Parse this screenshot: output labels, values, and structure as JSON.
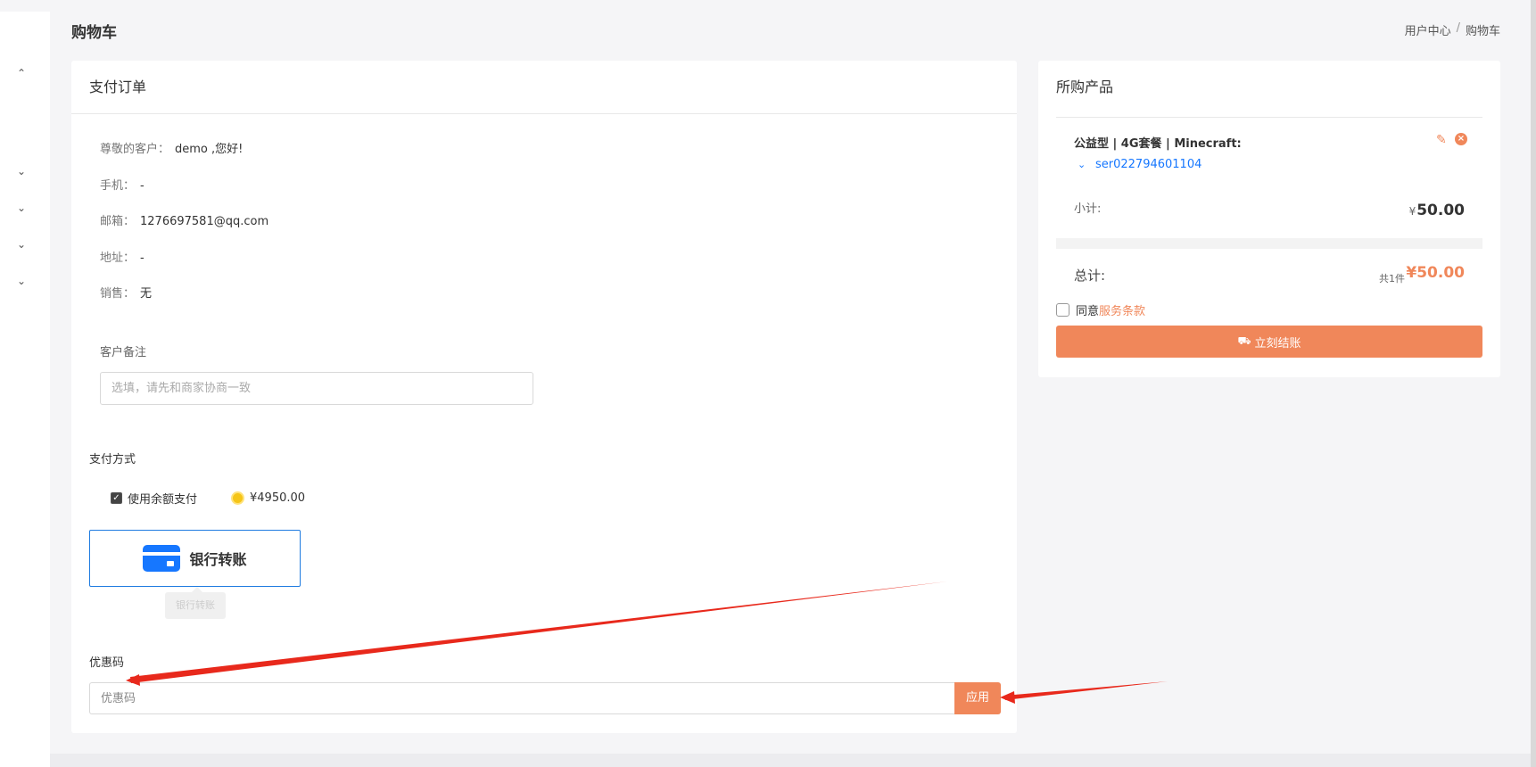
{
  "header": {
    "title": "购物车",
    "breadcrumb": [
      "用户中心",
      "/",
      "购物车"
    ]
  },
  "order": {
    "title": "支付订单",
    "customer_label": "尊敬的客户：",
    "customer_value": "demo ,您好!",
    "phone_label": "手机：",
    "phone_value": "-",
    "email_label": "邮箱：",
    "email_value": "1276697581@qq.com",
    "address_label": "地址：",
    "address_value": "-",
    "sales_label": "销售：",
    "sales_value": "无",
    "remark_label": "客户备注",
    "remark_placeholder": "选填，请先和商家协商一致"
  },
  "payment": {
    "label": "支付方式",
    "balance_checked": true,
    "balance_label": "使用余额支付",
    "balance_amount": "¥4950.00",
    "bank_label": "银行转账",
    "tooltip": "银行转账"
  },
  "coupon": {
    "label": "优惠码",
    "placeholder": "优惠码",
    "apply_label": "应用"
  },
  "cart": {
    "title": "所购产品",
    "product_name": "公益型 | 4G套餐 | Minecraft:",
    "server_id": "ser022794601104",
    "subtotal_label": "小计:",
    "subtotal_currency": "¥",
    "subtotal_value": "50.00",
    "total_label": "总计:",
    "total_count": "共1件",
    "total_value": "¥50.00",
    "agree_prefix": "同意",
    "terms_link": "服务条款",
    "checkout_label": "立刻结账",
    "agree_checked": false
  },
  "icons": {
    "rail": [
      "chevron-up-icon",
      "chevron-down-icon",
      "chevron-down-icon",
      "chevron-down-icon",
      "chevron-down-icon"
    ],
    "edit": "pencil-icon",
    "remove": "close-circle-icon",
    "expand": "chevron-down-icon",
    "checkout": "truck-icon",
    "balance": "coin-icon",
    "bank": "bank-card-icon"
  },
  "colors": {
    "accent": "#f0875a",
    "link": "#1677ff",
    "annotation_arrow": "#e8291c",
    "background": "#f5f5f7"
  }
}
